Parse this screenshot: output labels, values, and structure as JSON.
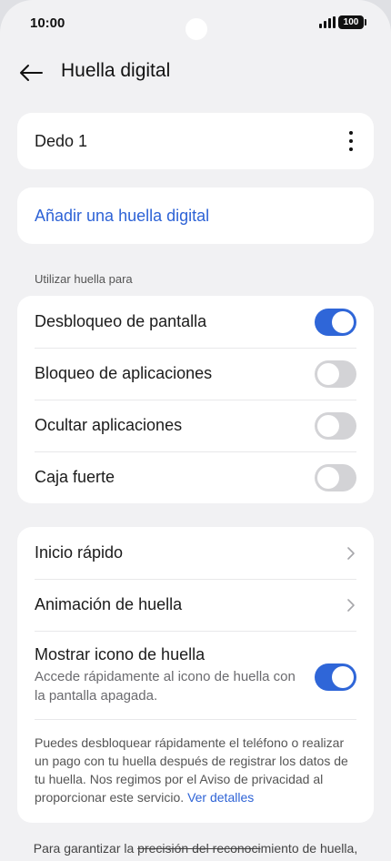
{
  "status_bar": {
    "time": "10:00",
    "battery": "100"
  },
  "header": {
    "title": "Huella digital"
  },
  "fingerprints": [
    {
      "label": "Dedo 1"
    }
  ],
  "add_fingerprint": {
    "label": "Añadir una huella digital"
  },
  "section": {
    "label": "Utilizar huella para"
  },
  "use_for": [
    {
      "label": "Desbloqueo de pantalla",
      "enabled": true
    },
    {
      "label": "Bloqueo de aplicaciones",
      "enabled": false
    },
    {
      "label": "Ocultar aplicaciones",
      "enabled": false
    },
    {
      "label": "Caja fuerte",
      "enabled": false
    }
  ],
  "options": {
    "quick_start": "Inicio rápido",
    "animation": "Animación de huella",
    "show_icon": {
      "label": "Mostrar icono de huella",
      "sub": "Accede rápidamente al icono de huella con la pantalla apagada.",
      "enabled": true
    },
    "description": "Puedes desbloquear rápidamente el teléfono o realizar un pago con tu huella después de registrar los datos de tu huella. Nos regimos por el Aviso de privacidad al proporcionar este servicio.",
    "details_link": "Ver detalles"
  },
  "footer": {
    "part1": "Para garantizar la ",
    "part2": "precisión del reconoci",
    "part3": "miento de huella,"
  },
  "colors": {
    "accent": "#2f66d8",
    "link": "#2e63d6",
    "background": "#f1f1f3"
  }
}
